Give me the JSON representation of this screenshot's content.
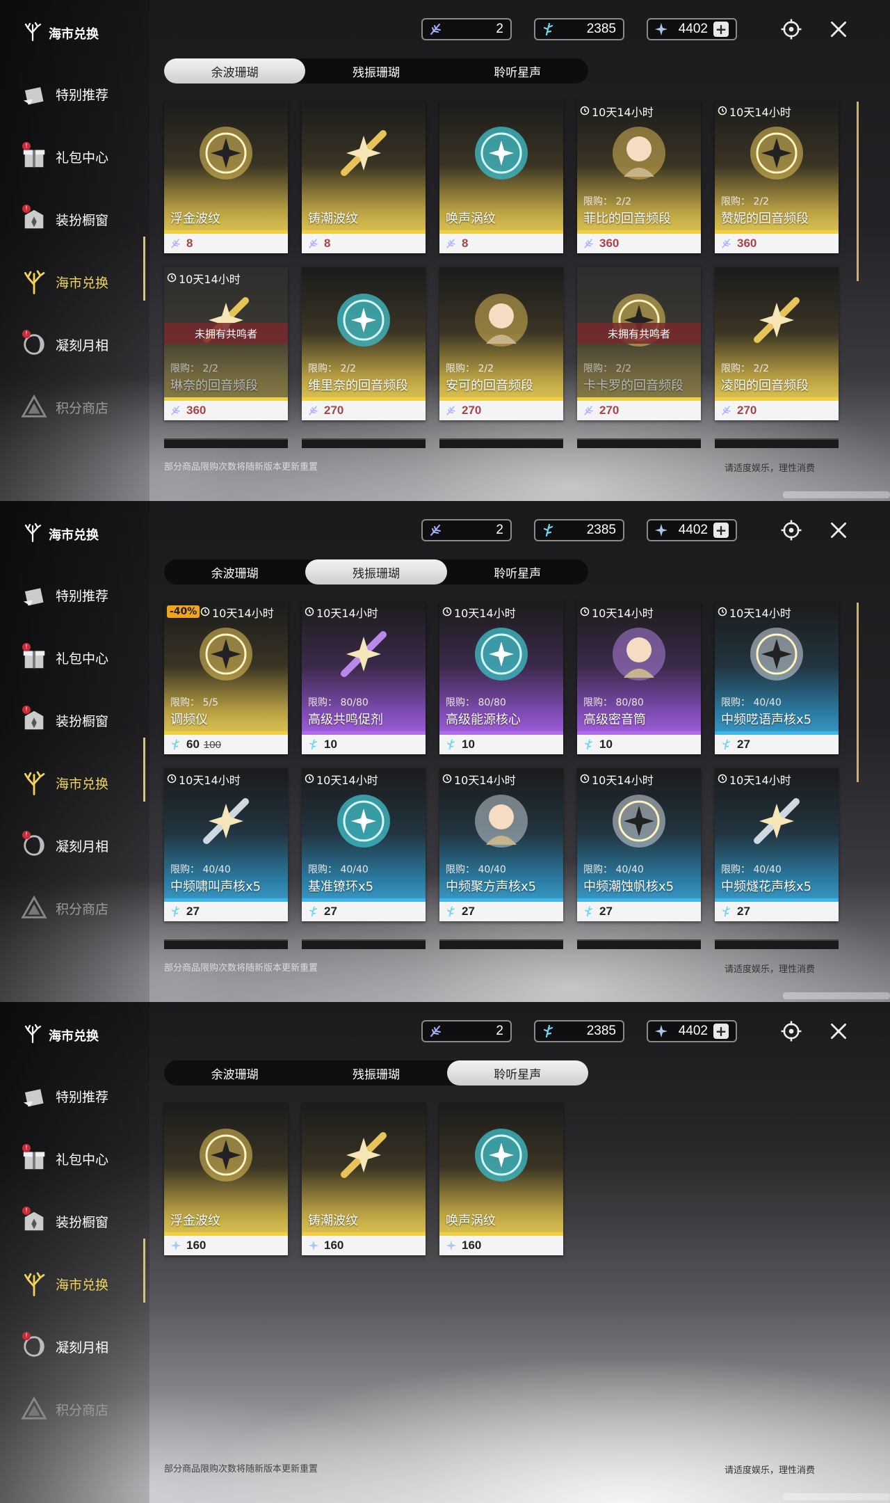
{
  "header": {
    "title": "海市兑换",
    "currencies": [
      {
        "icon": "coral-feather-icon",
        "value": "2"
      },
      {
        "icon": "coral-blue-icon",
        "value": "2385"
      },
      {
        "icon": "star-sound-icon",
        "value": "4402",
        "plus": "+"
      }
    ]
  },
  "nav": [
    {
      "label": "特别推荐",
      "icon": "gift-hand-icon"
    },
    {
      "label": "礼包中心",
      "icon": "gift-box-icon",
      "badge": "!"
    },
    {
      "label": "装扮橱窗",
      "icon": "wardrobe-icon",
      "badge": "!"
    },
    {
      "label": "海市兑换",
      "icon": "coral-icon",
      "active": true
    },
    {
      "label": "凝刻月相",
      "icon": "moon-phase-icon",
      "badge": "!"
    },
    {
      "label": "积分商店",
      "icon": "points-triangle-icon",
      "dim": true
    }
  ],
  "tabs": [
    "余波珊瑚",
    "残振珊瑚",
    "聆听星声"
  ],
  "panels": [
    {
      "active_tab": 0,
      "items": [
        {
          "name": "浮金波纹",
          "price": "8",
          "color": "gold",
          "price_color": "red"
        },
        {
          "name": "铸潮波纹",
          "price": "8",
          "color": "gold",
          "price_color": "red"
        },
        {
          "name": "唤声涡纹",
          "price": "8",
          "color": "gold",
          "price_color": "red"
        },
        {
          "name": "菲比的回音频段",
          "price": "360",
          "color": "gold",
          "timer": "10天14小时",
          "limit": "限购： 2/2",
          "price_color": "red"
        },
        {
          "name": "赞妮的回音频段",
          "price": "360",
          "color": "gold",
          "timer": "10天14小时",
          "limit": "限购： 2/2",
          "price_color": "red"
        },
        {
          "name": "琳奈的回音频段",
          "price": "360",
          "color": "gold",
          "timer": "10天14小时",
          "limit": "限购： 2/2",
          "unowned": "未拥有共鸣者",
          "price_color": "red"
        },
        {
          "name": "维里奈的回音频段",
          "price": "270",
          "color": "gold",
          "limit": "限购： 2/2",
          "price_color": "red"
        },
        {
          "name": "安可的回音频段",
          "price": "270",
          "color": "gold",
          "limit": "限购： 2/2",
          "price_color": "red"
        },
        {
          "name": "卡卡罗的回音频段",
          "price": "270",
          "color": "gold",
          "limit": "限购： 2/2",
          "unowned": "未拥有共鸣者",
          "price_color": "red"
        },
        {
          "name": "凌阳的回音频段",
          "price": "270",
          "color": "gold",
          "limit": "限购： 2/2",
          "price_color": "red"
        }
      ]
    },
    {
      "active_tab": 1,
      "items": [
        {
          "name": "调频仪",
          "price": "60",
          "old_price": "100",
          "discount": "-40%",
          "timer": "10天14小时",
          "limit": "限购： 5/5",
          "color": "gold"
        },
        {
          "name": "高级共鸣促剂",
          "price": "10",
          "timer": "10天14小时",
          "limit": "限购： 80/80",
          "color": "purple"
        },
        {
          "name": "高级能源核心",
          "price": "10",
          "timer": "10天14小时",
          "limit": "限购： 80/80",
          "color": "purple"
        },
        {
          "name": "高级密音筒",
          "price": "10",
          "timer": "10天14小时",
          "limit": "限购： 80/80",
          "color": "purple"
        },
        {
          "name": "中频呓语声核x5",
          "price": "27",
          "timer": "10天14小时",
          "limit": "限购： 40/40",
          "color": "blue"
        },
        {
          "name": "中频啸叫声核x5",
          "price": "27",
          "timer": "10天14小时",
          "limit": "限购： 40/40",
          "color": "blue"
        },
        {
          "name": "基准镣环x5",
          "price": "27",
          "timer": "10天14小时",
          "limit": "限购： 40/40",
          "color": "blue"
        },
        {
          "name": "中频聚方声核x5",
          "price": "27",
          "timer": "10天14小时",
          "limit": "限购： 40/40",
          "color": "blue"
        },
        {
          "name": "中频潮蚀帆核x5",
          "price": "27",
          "timer": "10天14小时",
          "limit": "限购： 40/40",
          "color": "blue"
        },
        {
          "name": "中频燧花声核x5",
          "price": "27",
          "timer": "10天14小时",
          "limit": "限购： 40/40",
          "color": "blue"
        }
      ]
    },
    {
      "active_tab": 2,
      "items": [
        {
          "name": "浮金波纹",
          "price": "160",
          "color": "gold"
        },
        {
          "name": "铸潮波纹",
          "price": "160",
          "color": "gold"
        },
        {
          "name": "唤声涡纹",
          "price": "160",
          "color": "gold"
        }
      ]
    }
  ],
  "footer": {
    "note": "部分商品限购次数将随新版本更新重置",
    "right": "请适度娱乐，理性消费"
  },
  "colors": {
    "gold": "#f0cf42",
    "purple": "#b06be8",
    "blue": "#41b5e8",
    "active_nav": "#f3d35a",
    "price_red": "#a8434a"
  }
}
